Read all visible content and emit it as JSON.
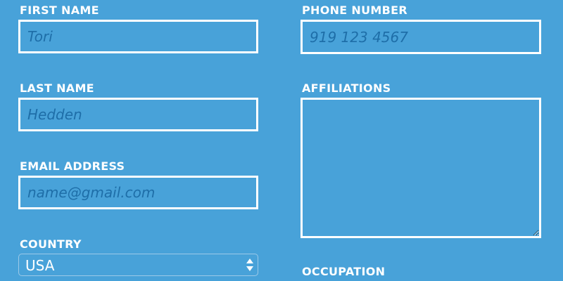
{
  "form": {
    "first_name": {
      "label": "FIRST NAME",
      "placeholder": "Tori",
      "value": ""
    },
    "last_name": {
      "label": "LAST NAME",
      "placeholder": "Hedden",
      "value": ""
    },
    "email": {
      "label": "EMAIL ADDRESS",
      "placeholder": "name@gmail.com",
      "value": ""
    },
    "country": {
      "label": "COUNTRY",
      "selected": "USA"
    },
    "phone": {
      "label": "PHONE NUMBER",
      "placeholder": "919 123 4567",
      "value": ""
    },
    "affiliations": {
      "label": "AFFILIATIONS",
      "value": ""
    },
    "occupation": {
      "label": "OCCUPATION"
    }
  },
  "colors": {
    "background": "#48a2d9",
    "border": "#ffffff",
    "label": "#ffffff",
    "placeholder": "#1e6ea8"
  },
  "icons": {
    "select_arrows": "up-down-chevron-icon",
    "resize_handle": "resize-grip-icon"
  }
}
